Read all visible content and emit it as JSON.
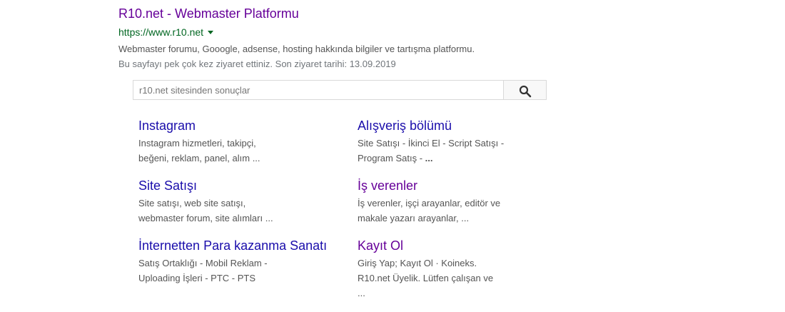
{
  "result": {
    "title": "R10.net - Webmaster Platformu",
    "url": "https://www.r10.net",
    "description": "Webmaster forumu, Gooogle, adsense, hosting hakkında bilgiler ve tartışma platformu.",
    "visited_note": "Bu sayfayı pek çok kez ziyaret ettiniz. Son ziyaret tarihi: 13.09.2019"
  },
  "site_search": {
    "placeholder": "r10.net sitesinden sonuçlar"
  },
  "sitelinks": [
    {
      "title": "Instagram",
      "lines": [
        "Instagram hizmetleri, takipçi,",
        "beğeni, reklam, panel, alım ..."
      ]
    },
    {
      "title": "Alışveriş bölümü",
      "lines": [
        "Site Satışı - İkinci El - Script Satışı -",
        "Program Satış - "
      ],
      "trail": "..."
    },
    {
      "title": "Site Satışı",
      "lines": [
        "Site satışı, web site satışı,",
        "webmaster forum, site alımları ..."
      ]
    },
    {
      "title": "İş verenler",
      "lines": [
        "İş verenler, işçi arayanlar, editör ve",
        "makale yazarı arayanlar, ..."
      ]
    },
    {
      "title": "İnternetten Para kazanma Sanatı",
      "lines": [
        "Satış Ortaklığı - Mobil Reklam -",
        "Uploading İşleri - PTC - PTS"
      ]
    },
    {
      "title": "Kayıt Ol",
      "lines": [
        "Giriş Yap; Kayıt Ol · Koineks.",
        "R10.net Üyelik. Lütfen çalışan ve",
        "..."
      ]
    }
  ],
  "colors": {
    "visited_link": "#660099",
    "link": "#1a0dab",
    "url_green": "#006621",
    "snippet": "#545454"
  }
}
